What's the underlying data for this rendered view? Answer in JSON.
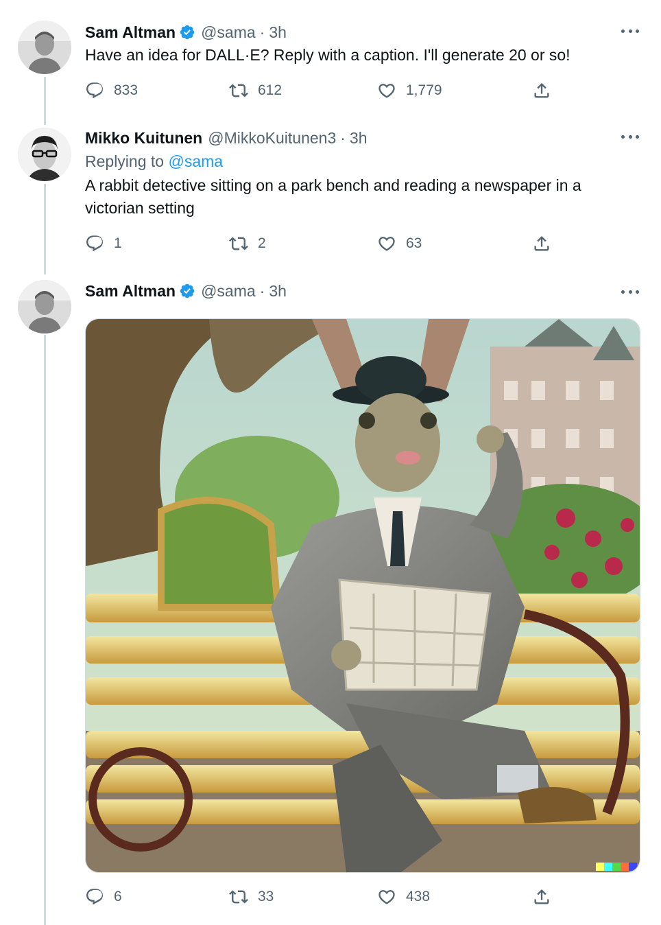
{
  "tweets": [
    {
      "name": "Sam Altman",
      "handle": "@sama",
      "time": "3h",
      "text": "Have an idea for DALL·E? Reply with a caption. I'll generate 20 or so!",
      "replies": "833",
      "retweets": "612",
      "likes": "1,779"
    },
    {
      "name": "Mikko Kuitunen",
      "handle": "@MikkoKuitunen3",
      "time": "3h",
      "replying_label": "Replying to",
      "replying_to": "@sama",
      "text": "A rabbit detective sitting on a park bench and reading a newspaper in a victorian setting",
      "replies": "1",
      "retweets": "2",
      "likes": "63"
    },
    {
      "name": "Sam Altman",
      "handle": "@sama",
      "time": "3h",
      "replies": "6",
      "retweets": "33",
      "likes": "438"
    }
  ],
  "separator": "·",
  "icons": {
    "verified": "verified-badge-icon",
    "more": "more-options-icon",
    "reply": "reply-icon",
    "retweet": "retweet-icon",
    "like": "heart-icon",
    "share": "share-icon"
  },
  "colors": {
    "accent": "#1d9bf0",
    "secondary_text": "#536471",
    "thread_line": "#cfd9de"
  }
}
